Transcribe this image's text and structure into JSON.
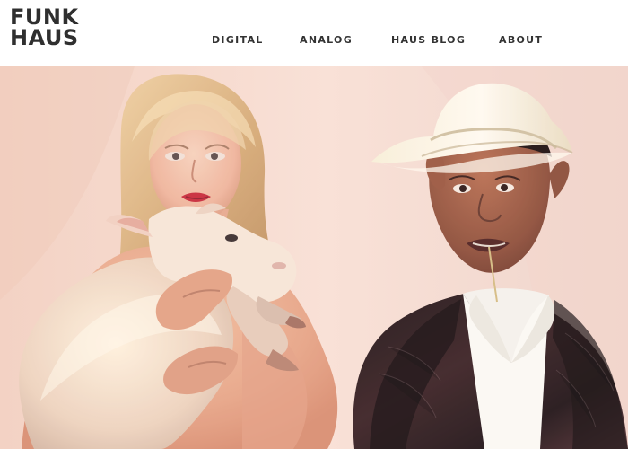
{
  "header": {
    "logo": {
      "line1": "FUNK",
      "line2": "HAUS"
    },
    "nav": {
      "digital": "DIGITAL",
      "analog": "ANALOG",
      "haus_blog": "HAUS BLOG",
      "about": "ABOUT"
    }
  },
  "colors": {
    "logo_text": "#2f2f2f",
    "nav_text": "#333333",
    "background": "#ffffff",
    "hero_backdrop": "#f6d9cc"
  }
}
